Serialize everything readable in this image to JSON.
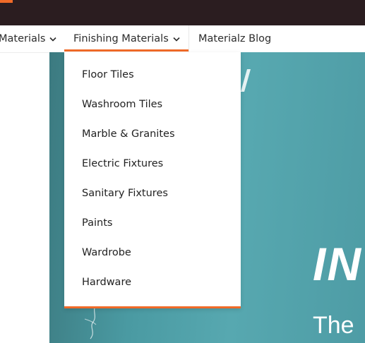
{
  "nav": {
    "items": [
      {
        "label": "Materials",
        "has_dropdown": true
      },
      {
        "label": "Finishing Materials",
        "has_dropdown": true,
        "active": true
      },
      {
        "label": "Materialz Blog",
        "has_dropdown": false
      }
    ]
  },
  "dropdown": {
    "items": [
      "Floor Tiles",
      "Washroom Tiles",
      "Marble & Granites",
      "Electric Fixtures",
      "Sanitary Fixtures",
      "Paints",
      "Wardrobe",
      "Hardware"
    ]
  },
  "hero": {
    "headline_fragment": "IN",
    "sub_fragment": "The"
  },
  "colors": {
    "accent": "#f06a28",
    "topbar": "#2b1d20",
    "hero_teal": "#4a9aa2"
  }
}
